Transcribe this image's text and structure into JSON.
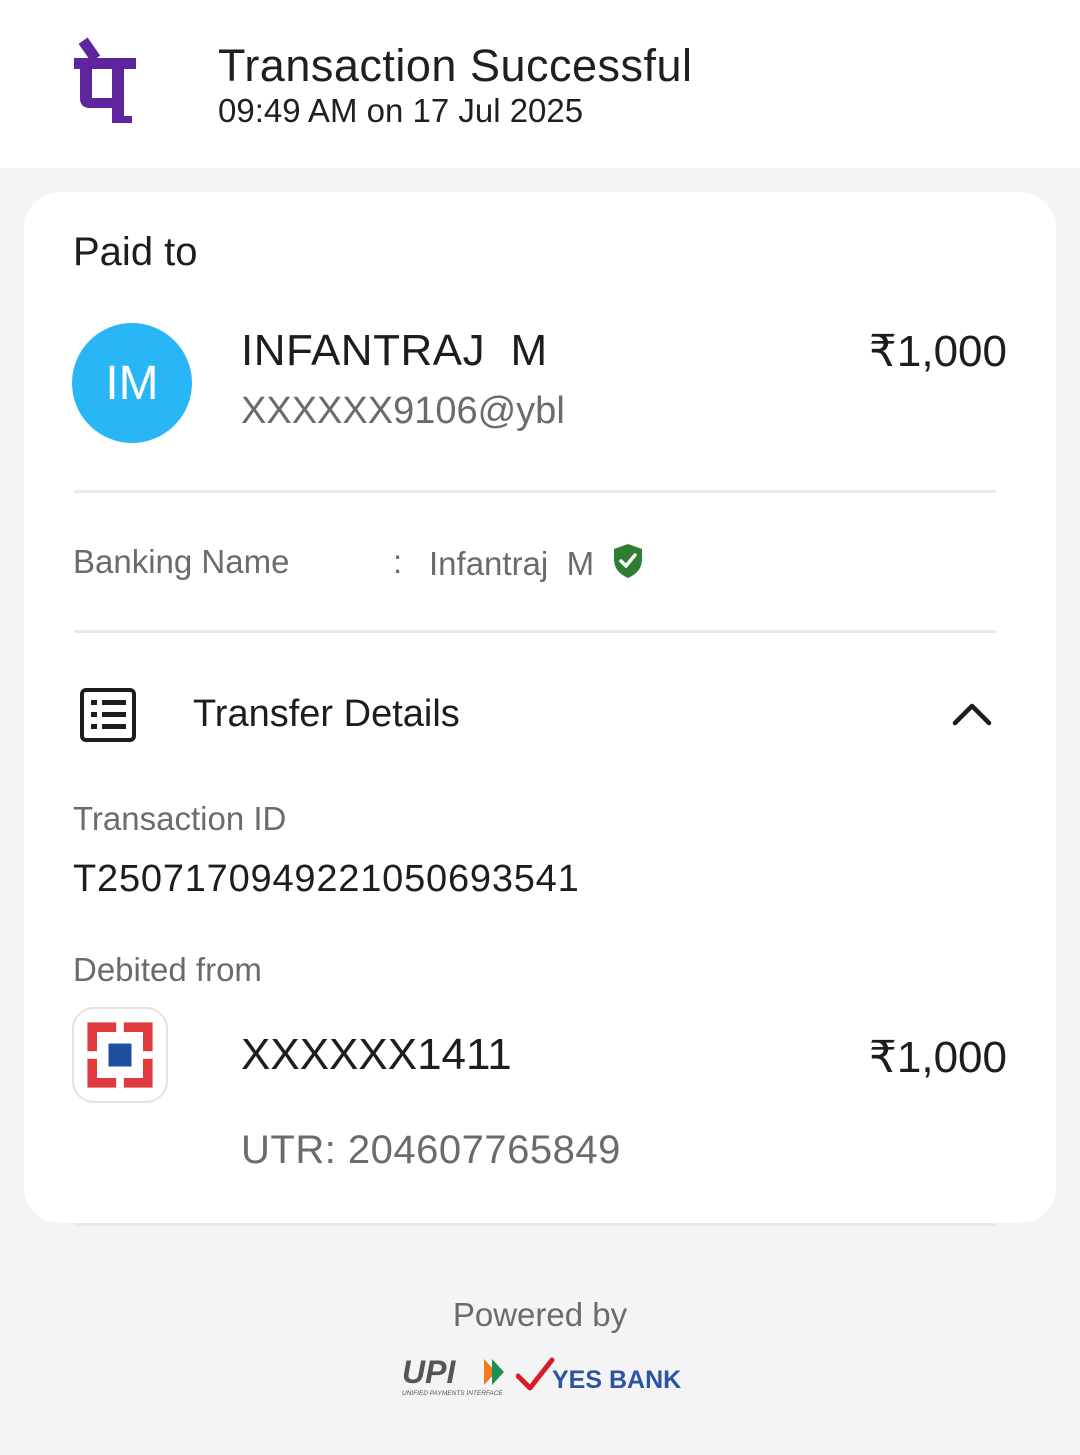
{
  "header": {
    "logo_icon": "phonepe-logo-icon",
    "title": "Transaction Successful",
    "timestamp": "09:49 AM on 17 Jul 2025"
  },
  "paid_to": {
    "label": "Paid to",
    "avatar_initials": "IM",
    "avatar_color": "#29b6f6",
    "name": "INFANTRAJ  M",
    "upi_id": "XXXXXX9106@ybl",
    "amount": "₹1,000"
  },
  "banking_name": {
    "label": "Banking Name",
    "separator": ":",
    "value": "Infantraj  M",
    "verified_icon": "shield-check-icon",
    "verified_color": "#2e7d32"
  },
  "transfer_details": {
    "icon": "list-icon",
    "title": "Transfer Details",
    "expand_icon": "chevron-up-icon",
    "transaction_id_label": "Transaction ID",
    "transaction_id": "T2507170949221050693541",
    "debited_from_label": "Debited from",
    "bank_icon": "hdfc-bank-icon",
    "account": "XXXXXX1411",
    "amount": "₹1,000",
    "utr": "UTR: 204607765849"
  },
  "footer": {
    "powered_by": "Powered by",
    "upi_logo_text": "UPI",
    "upi_tagline": "UNIFIED PAYMENTS INTERFACE",
    "partner_bank": "YES BANK"
  },
  "colors": {
    "brand_purple": "#5f259f",
    "page_bg": "#f4f4f4",
    "hdfc_red": "#e03a3e",
    "hdfc_blue": "#1f4fa0",
    "yes_bank_blue": "#2d54a3",
    "yes_bank_red": "#d71e28"
  }
}
